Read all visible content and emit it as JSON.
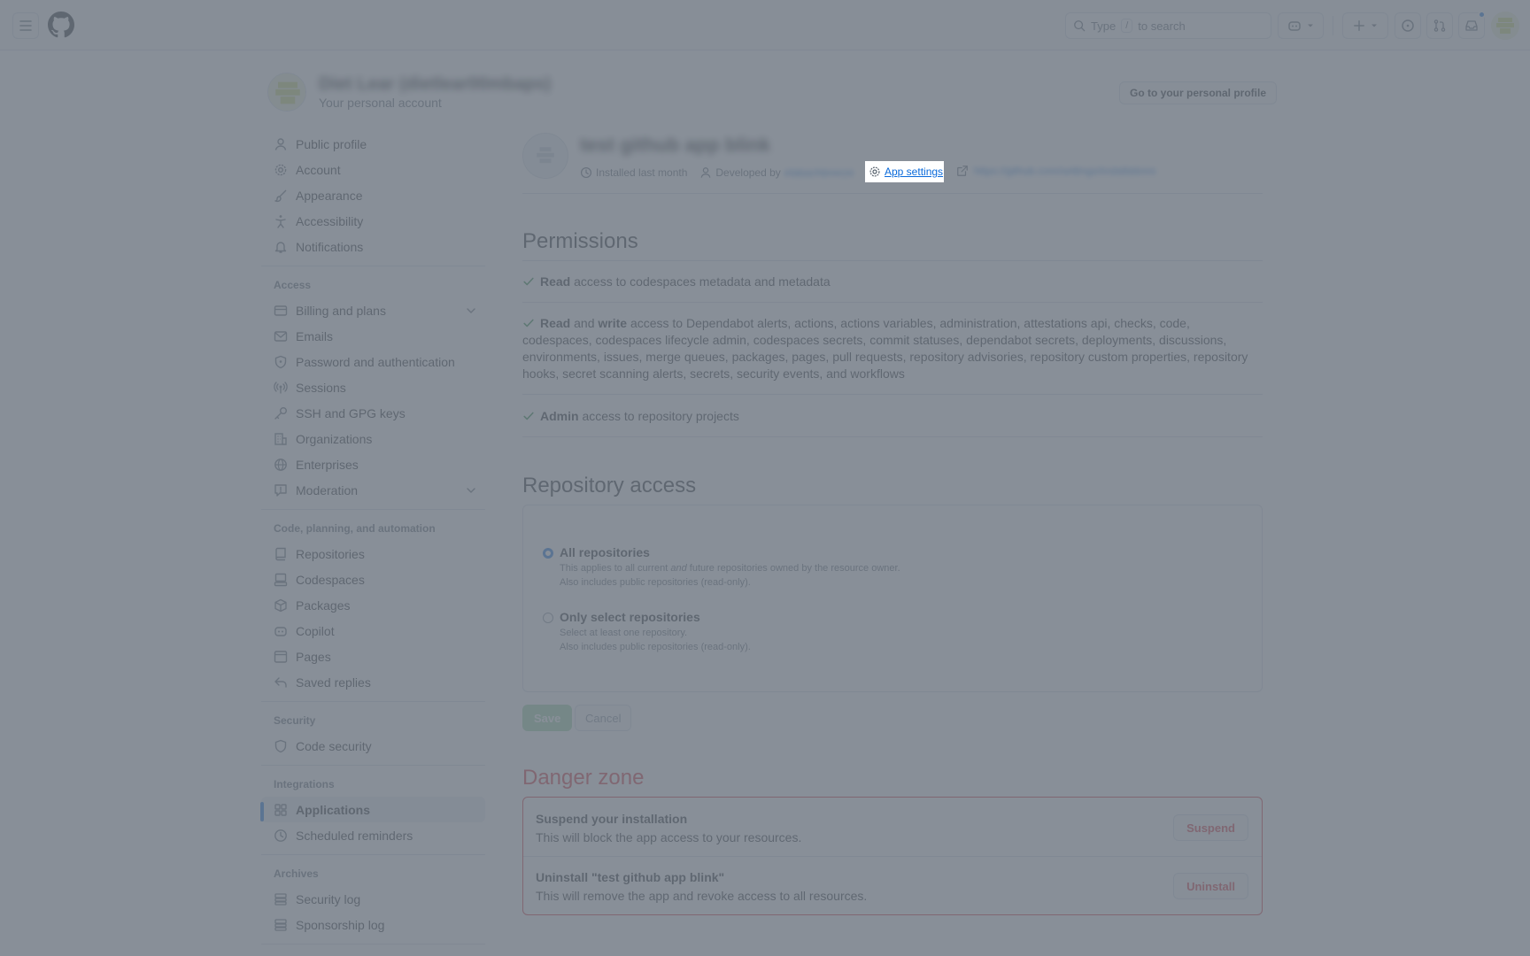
{
  "header": {
    "search_prefix": "Type",
    "search_key": "/",
    "search_suffix": "to search"
  },
  "account": {
    "name": "Diet Lear (dietlear00mbaps)",
    "subtitle": "Your personal account",
    "go_profile": "Go to your personal profile"
  },
  "sidebar": {
    "top": [
      {
        "label": "Public profile",
        "icon": "person-icon"
      },
      {
        "label": "Account",
        "icon": "gear-icon"
      },
      {
        "label": "Appearance",
        "icon": "paintbrush-icon"
      },
      {
        "label": "Accessibility",
        "icon": "accessibility-icon"
      },
      {
        "label": "Notifications",
        "icon": "bell-icon"
      }
    ],
    "access_title": "Access",
    "access": [
      {
        "label": "Billing and plans",
        "icon": "credit-card-icon"
      },
      {
        "label": "Emails",
        "icon": "mail-icon"
      },
      {
        "label": "Password and authentication",
        "icon": "shield-lock-icon"
      },
      {
        "label": "Sessions",
        "icon": "broadcast-icon"
      },
      {
        "label": "SSH and GPG keys",
        "icon": "key-icon"
      },
      {
        "label": "Organizations",
        "icon": "organization-icon"
      },
      {
        "label": "Enterprises",
        "icon": "globe-icon"
      },
      {
        "label": "Moderation",
        "icon": "report-icon"
      }
    ],
    "code_title": "Code, planning, and automation",
    "code": [
      {
        "label": "Repositories",
        "icon": "repo-icon"
      },
      {
        "label": "Codespaces",
        "icon": "codespaces-icon"
      },
      {
        "label": "Packages",
        "icon": "package-icon"
      },
      {
        "label": "Copilot",
        "icon": "copilot-icon"
      },
      {
        "label": "Pages",
        "icon": "browser-icon"
      },
      {
        "label": "Saved replies",
        "icon": "reply-icon"
      }
    ],
    "security_title": "Security",
    "security": [
      {
        "label": "Code security",
        "icon": "shield-icon"
      }
    ],
    "integrations_title": "Integrations",
    "integrations": [
      {
        "label": "Applications",
        "icon": "apps-icon"
      },
      {
        "label": "Scheduled reminders",
        "icon": "clock-icon"
      }
    ],
    "archives_title": "Archives",
    "archives": [
      {
        "label": "Security log",
        "icon": "log-icon"
      },
      {
        "label": "Sponsorship log",
        "icon": "log-icon"
      }
    ]
  },
  "app": {
    "title": "test github app blink",
    "installed": "Installed last month",
    "developed_by": "Developed by",
    "developer": "elabachbreeze",
    "settings_link": "App settings",
    "external_url": "https://github.com/settings/installations"
  },
  "permissions": {
    "title": "Permissions",
    "read_word": "Read",
    "p1_rest": "access to codespaces metadata and metadata",
    "and_word": "and",
    "write_word": "write",
    "p2_rest": "access to Dependabot alerts, actions, actions variables, administration, attestations api, checks, code, codespaces, codespaces lifecycle admin, codespaces secrets, commit statuses, dependabot secrets, deployments, discussions, environments, issues, merge queues, packages, pages, pull requests, repository advisories, repository custom properties, repository hooks, secret scanning alerts, secrets, security events, and workflows",
    "admin_word": "Admin",
    "p3_rest": "access to repository projects"
  },
  "repo_access": {
    "title": "Repository access",
    "all_label": "All repositories",
    "all_desc1_a": "This applies to all current",
    "all_desc1_and": "and",
    "all_desc1_b": "future repositories owned by the resource owner.",
    "all_desc2": "Also includes public repositories (read-only).",
    "select_label": "Only select repositories",
    "select_desc1": "Select at least one repository.",
    "select_desc2": "Also includes public repositories (read-only).",
    "selected": "All repositories",
    "save": "Save",
    "cancel": "Cancel"
  },
  "danger": {
    "title": "Danger zone",
    "suspend_title": "Suspend your installation",
    "suspend_desc": "This will block the app access to your resources.",
    "suspend_btn": "Suspend",
    "uninstall_title": "Uninstall \"test github app blink\"",
    "uninstall_desc": "This will remove the app and revoke access to all resources.",
    "uninstall_btn": "Uninstall"
  },
  "colors": {
    "accent": "#0969da",
    "danger": "#d1242f",
    "success": "#1a7f37"
  }
}
